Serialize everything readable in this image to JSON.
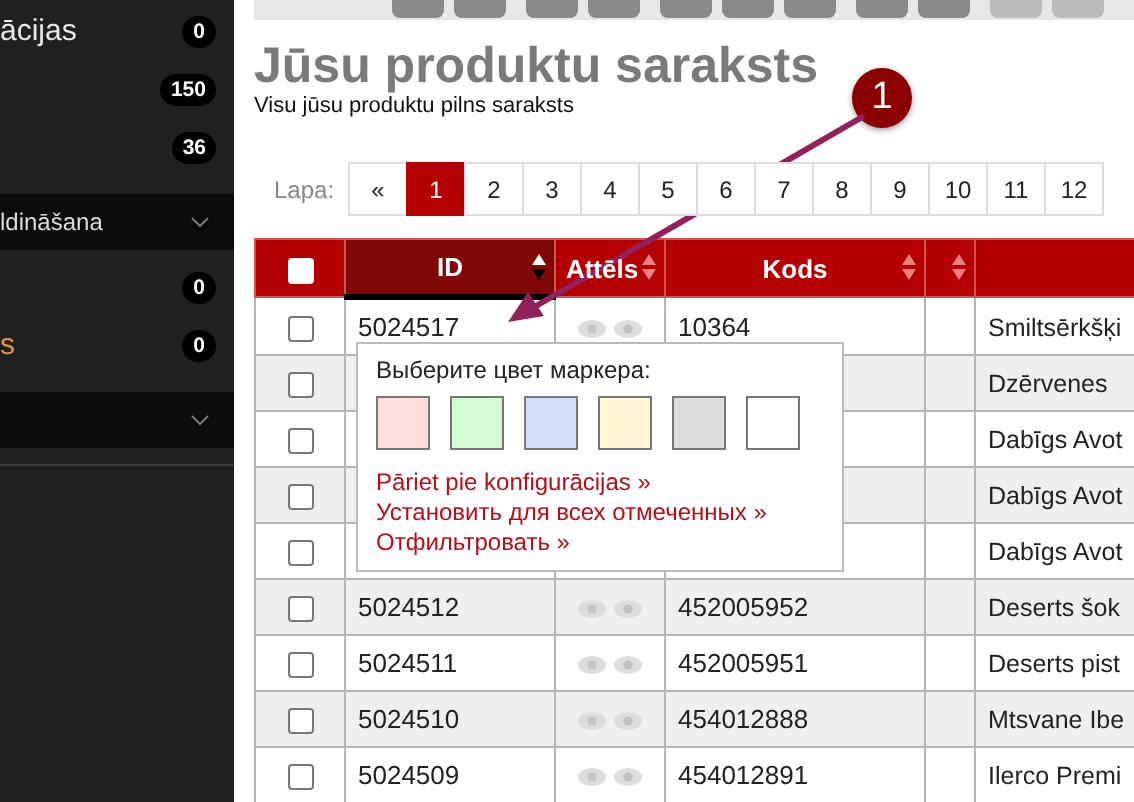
{
  "sidebar": {
    "items": [
      {
        "kind": "item",
        "label": "ācijas",
        "count": "0"
      },
      {
        "kind": "item",
        "count": "150"
      },
      {
        "kind": "item",
        "count": "36"
      },
      {
        "kind": "section",
        "label": "ldināšana"
      },
      {
        "kind": "item",
        "count": "0"
      },
      {
        "kind": "active",
        "label": "s",
        "count": "0"
      },
      {
        "kind": "section"
      }
    ]
  },
  "toolbar": {
    "buttons": [
      {
        "disabled": false
      },
      {
        "disabled": false
      },
      {
        "disabled": false
      },
      {
        "disabled": false
      },
      {
        "disabled": false
      },
      {
        "disabled": false
      },
      {
        "disabled": false
      },
      {
        "disabled": false
      },
      {
        "disabled": false
      },
      {
        "disabled": true
      },
      {
        "disabled": true
      }
    ]
  },
  "page": {
    "title": "Jūsu produktu saraksts",
    "subtitle": "Visu jūsu produktu pilns saraksts"
  },
  "pagination": {
    "label": "Lapa:",
    "prev": "«",
    "pages": [
      {
        "label": "1",
        "selected": true
      },
      {
        "label": "2",
        "selected": false
      },
      {
        "label": "3",
        "selected": false
      },
      {
        "label": "4",
        "selected": false
      },
      {
        "label": "5",
        "selected": false
      },
      {
        "label": "6",
        "selected": false
      },
      {
        "label": "7",
        "selected": false
      },
      {
        "label": "8",
        "selected": false
      },
      {
        "label": "9",
        "selected": false
      },
      {
        "label": "10",
        "selected": false
      },
      {
        "label": "11",
        "selected": false
      },
      {
        "label": "12",
        "selected": false
      }
    ]
  },
  "table": {
    "header_checkbox": {
      "checked": false
    },
    "columns": [
      {
        "label": "ID",
        "sorted": true
      },
      {
        "label": "Attēls",
        "sorted": false
      },
      {
        "label": "Kods",
        "sorted": false
      },
      {
        "sorted": false
      },
      {}
    ],
    "rows": [
      {
        "checked": false,
        "id": "5024517",
        "code": "10364",
        "name": "Smiltsērkšķi"
      },
      {
        "checked": false,
        "name": "Dzērvenes"
      },
      {
        "checked": false,
        "name": "Dabīgs Avot"
      },
      {
        "checked": false,
        "name": "Dabīgs Avot"
      },
      {
        "checked": false,
        "name": "Dabīgs Avot"
      },
      {
        "checked": false,
        "id": "5024512",
        "code": "452005952",
        "name": "Deserts šok"
      },
      {
        "checked": false,
        "id": "5024511",
        "code": "452005951",
        "name": "Deserts pist"
      },
      {
        "checked": false,
        "id": "5024510",
        "code": "454012888",
        "name": "Mtsvane Ibe"
      },
      {
        "checked": false,
        "id": "5024509",
        "code": "454012891",
        "name": "Ilerco Premi"
      }
    ]
  },
  "marker_popup": {
    "title": "Выберите цвет маркера:",
    "swatches": [
      {
        "color": "#ffdddd"
      },
      {
        "color": "#d4fcd4"
      },
      {
        "color": "#d4defc"
      },
      {
        "color": "#fff6d4"
      },
      {
        "color": "#dddddd"
      },
      {
        "color": "#ffffff"
      }
    ],
    "links": [
      "Pāriet pie konfigurācijas »",
      "Установить для всех отмеченных »",
      "Отфильтровать »"
    ]
  },
  "annotation": {
    "label": "1"
  }
}
